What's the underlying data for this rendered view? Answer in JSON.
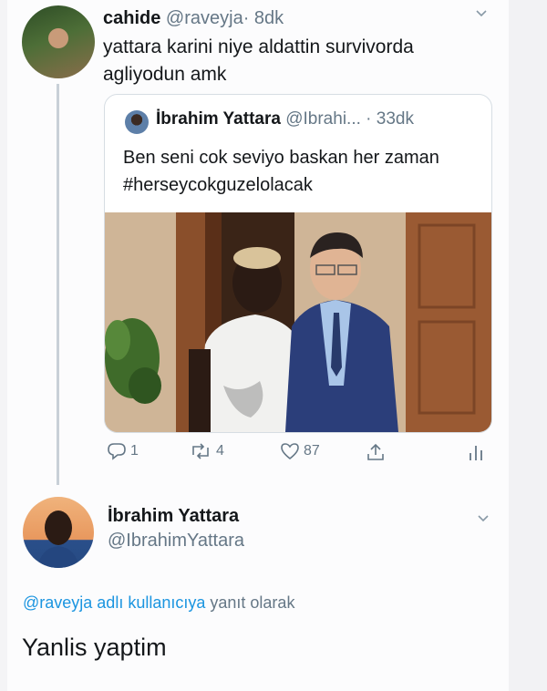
{
  "tweet": {
    "author_name": "cahide",
    "author_handle": "@raveyja",
    "time": "· 8dk",
    "text": "yattara karini niye aldattin survivorda agliyodun amk"
  },
  "quoted_tweet": {
    "author_name": "İbrahim Yattara",
    "author_handle": "@Ibrahi...",
    "time": "· 33dk",
    "text": "Ben seni cok seviyo baskan her zaman #herseycokguzelolacak"
  },
  "actions": {
    "reply_count": "1",
    "retweet_count": "4",
    "like_count": "87"
  },
  "reply": {
    "author_name": "İbrahim Yattara",
    "author_handle": "@IbrahimYattara",
    "reply_to_link": "@raveyja adlı kullanıcıya",
    "reply_to_suffix": "yanıt olarak",
    "text": "Yanlis yaptim"
  },
  "colors": {
    "link": "#1b95e0",
    "secondary_text": "#657786",
    "primary_text": "#14171a"
  },
  "icons": [
    "chevron-down-icon",
    "reply-icon",
    "retweet-icon",
    "like-icon",
    "share-icon",
    "analytics-icon"
  ]
}
